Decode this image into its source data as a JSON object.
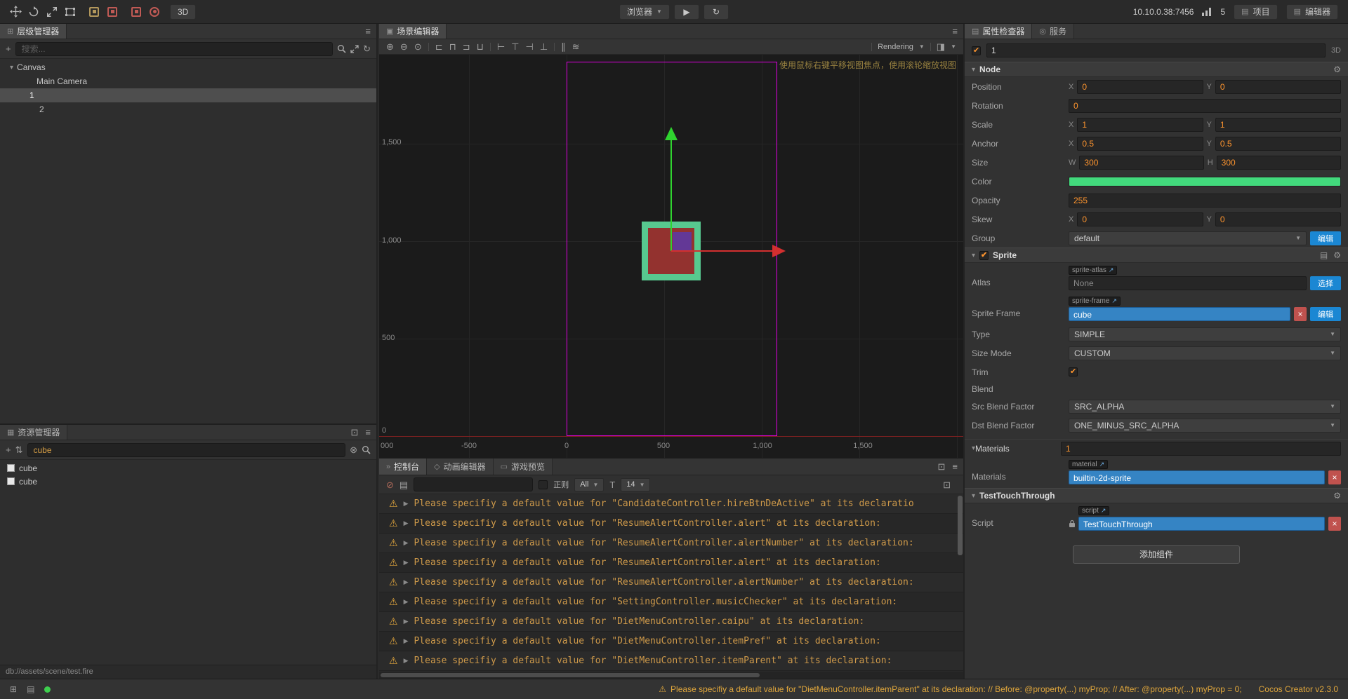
{
  "toolbar": {
    "ip": "10.10.0.38:7456",
    "connections": "5",
    "project_btn": "项目",
    "editor_btn": "编辑器",
    "preview_target": "浏览器",
    "btn_3d": "3D"
  },
  "icons": {
    "menu": "≡",
    "caret": "▼",
    "tree_open": "▾",
    "plus": "+",
    "sort": "⇅",
    "refresh": "↻",
    "zoom_in": "⊕",
    "zoom_out": "⊖",
    "zoom_one": "⊙",
    "align_left": "⊏",
    "align_top": "⊓",
    "align_right": "⊐",
    "align_bottom": "⊔",
    "edge_left": "⊢",
    "edge_top": "⊤",
    "edge_right": "⊣",
    "edge_bottom": "⊥",
    "dist_h": "∥",
    "dist_v": "≋",
    "camera": "◨",
    "clear": "⊘",
    "doc": "▤",
    "font": "T",
    "detach": "⊡",
    "warning": "⚠",
    "expander": "▶",
    "play": "▶",
    "gear": "⚙",
    "copy": "▤",
    "external": "↗",
    "close": "×",
    "clear_search": "⊗",
    "dock": "⊞",
    "scene_tab": "▣",
    "hierarchy_tab": "⊞",
    "assets_tab": "▦",
    "inspector_tab": "▤",
    "service_tab": "◎",
    "console_tab": "»",
    "anim_tab": "◇",
    "preview_tab": "▭",
    "folder": "▤"
  },
  "hierarchy": {
    "tab": "层级管理器",
    "search_placeholder": "搜索...",
    "nodes": [
      {
        "label": "Canvas"
      },
      {
        "label": "Main Camera"
      },
      {
        "label": "1"
      },
      {
        "label": "2"
      }
    ]
  },
  "assets": {
    "tab": "资源管理器",
    "search_value": "cube",
    "items": [
      {
        "label": "cube"
      },
      {
        "label": "cube"
      }
    ],
    "path": "db://assets/scene/test.fire"
  },
  "scene": {
    "tab": "场景编辑器",
    "rendering_label": "Rendering",
    "hint": "使用鼠标右键平移视图焦点，使用滚轮缩放视图",
    "ruler_y": [
      "1,500",
      "1,000",
      "500",
      "0"
    ],
    "ruler_x": [
      "000",
      "-500",
      "0",
      "500",
      "1,000",
      "1,500"
    ]
  },
  "console": {
    "tab_console": "控制台",
    "tab_anim": "动画编辑器",
    "tab_preview": "游戏预览",
    "regex_label": "正则",
    "filter_value": "All",
    "font_size": "14",
    "logs": [
      {
        "text": "Please specifiy a default value for \"CandidateController.hireBtnDeActive\" at its declaratio"
      },
      {
        "text": "Please specifiy a default value for \"ResumeAlertController.alert\" at its declaration:"
      },
      {
        "text": "Please specifiy a default value for \"ResumeAlertController.alertNumber\" at its declaration:"
      },
      {
        "text": "Please specifiy a default value for \"ResumeAlertController.alert\" at its declaration:"
      },
      {
        "text": "Please specifiy a default value for \"ResumeAlertController.alertNumber\" at its declaration:"
      },
      {
        "text": "Please specifiy a default value for \"SettingController.musicChecker\" at its declaration:"
      },
      {
        "text": "Please specifiy a default value for \"DietMenuController.caipu\" at its declaration:"
      },
      {
        "text": "Please specifiy a default value for \"DietMenuController.itemPref\" at its declaration:"
      },
      {
        "text": "Please specifiy a default value for \"DietMenuController.itemParent\" at its declaration:"
      }
    ]
  },
  "inspector": {
    "tab_inspector": "属性检查器",
    "tab_service": "服务",
    "node_name": "1",
    "badge_3d": "3D",
    "axis": {
      "x": "X",
      "y": "Y",
      "w": "W",
      "h": "H"
    },
    "node": {
      "title": "Node",
      "position": {
        "label": "Position",
        "x": "0",
        "y": "0"
      },
      "rotation": {
        "label": "Rotation",
        "value": "0"
      },
      "scale": {
        "label": "Scale",
        "x": "1",
        "y": "1"
      },
      "anchor": {
        "label": "Anchor",
        "x": "0.5",
        "y": "0.5"
      },
      "size": {
        "label": "Size",
        "w": "300",
        "h": "300"
      },
      "color": {
        "label": "Color",
        "value": "#42d97c"
      },
      "opacity": {
        "label": "Opacity",
        "value": "255"
      },
      "skew": {
        "label": "Skew",
        "x": "0",
        "y": "0"
      },
      "group": {
        "label": "Group",
        "value": "default",
        "button": "编辑"
      }
    },
    "sprite": {
      "title": "Sprite",
      "atlas": {
        "label": "Atlas",
        "chip": "sprite-atlas",
        "value": "None",
        "button": "选择"
      },
      "sprite_frame": {
        "label": "Sprite Frame",
        "chip": "sprite-frame",
        "value": "cube",
        "button": "编辑"
      },
      "type": {
        "label": "Type",
        "value": "SIMPLE"
      },
      "size_mode": {
        "label": "Size Mode",
        "value": "CUSTOM"
      },
      "trim": {
        "label": "Trim"
      },
      "blend": {
        "label": "Blend"
      },
      "src_blend": {
        "label": "Src Blend Factor",
        "value": "SRC_ALPHA"
      },
      "dst_blend": {
        "label": "Dst Blend Factor",
        "value": "ONE_MINUS_SRC_ALPHA"
      }
    },
    "materials": {
      "title": "Materials",
      "count": "1",
      "row": {
        "label": "Materials",
        "chip": "material",
        "value": "builtin-2d-sprite"
      }
    },
    "script_component": {
      "title": "TestTouchThrough",
      "row": {
        "label": "Script",
        "chip": "script",
        "value": "TestTouchThrough"
      }
    },
    "add_component": "添加组件"
  },
  "statusbar": {
    "message": "Please specifiy a default value for \"DietMenuController.itemParent\" at its declaration: // Before: @property(...) myProp; // After: @property(...) myProp = 0;",
    "version": "Cocos Creator v2.3.0"
  },
  "colors": {
    "accent_orange": "#fd942e",
    "warning_text": "#cf9a4a",
    "asset_ref_blue": "#3584c4",
    "action_blue": "#1b87d3",
    "remove_red": "#c0524e",
    "color_swatch_green": "#42d97c",
    "design_rect_magenta": "#e100e1",
    "gizmo_green": "#2fd32f",
    "gizmo_red": "#d32f2f",
    "sprite_border_green": "#57c98f",
    "sprite_fill_red": "#93322f",
    "xy_handle_purple": "#503097"
  }
}
